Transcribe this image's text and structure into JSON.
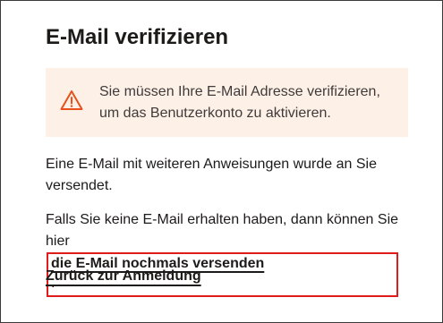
{
  "page": {
    "title": "E-Mail verifizieren"
  },
  "alert": {
    "icon": "warning-triangle-icon",
    "line1": "Sie müssen Ihre E-Mail Adresse verifizieren,",
    "line2": "um das Benutzerkonto zu aktivieren.",
    "background": "#fdf1e7",
    "icon_color": "#e8501c"
  },
  "info": {
    "line1": "Eine E-Mail mit weiteren Anweisungen wurde an Sie",
    "line2": "versendet."
  },
  "resend": {
    "line1": "Falls Sie keine E-Mail erhalten haben, dann können Sie",
    "prefix": "hier",
    "link_label": "die E-Mail nochmals versenden",
    "suffix": ".",
    "highlight_color": "#e01b1b"
  },
  "back": {
    "label": "Zurück zur Anmeldung"
  }
}
